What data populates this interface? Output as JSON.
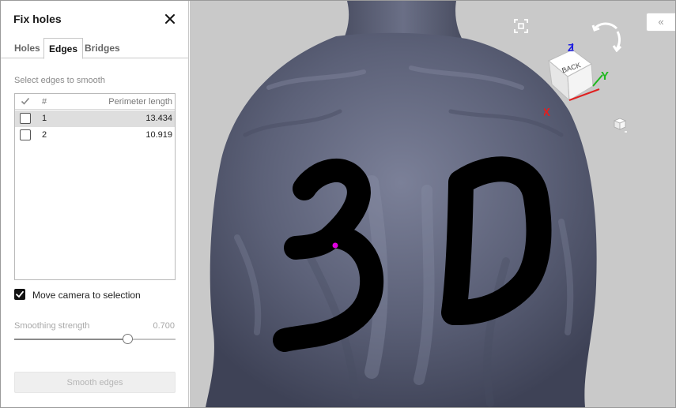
{
  "panel": {
    "title": "Fix holes",
    "tabs": [
      "Holes",
      "Edges",
      "Bridges"
    ],
    "active_tab": "Edges",
    "section_label": "Select edges to smooth",
    "list": {
      "header_num": "#",
      "header_perimeter": "Perimeter length",
      "rows": [
        {
          "id": "1",
          "perimeter": "13.434",
          "checked": false,
          "selected": true
        },
        {
          "id": "2",
          "perimeter": "10.919",
          "checked": false,
          "selected": false
        }
      ]
    },
    "move_camera_label": "Move camera to selection",
    "move_camera_checked": true,
    "smoothing_label": "Smoothing strength",
    "smoothing_value": "0.700",
    "smoothing_fraction": 0.7,
    "smooth_button": "Smooth edges"
  },
  "viewport": {
    "collapse_label": "«",
    "cube_face_label": "BACK",
    "axes": {
      "x": "X",
      "y": "Y",
      "z": "Z"
    },
    "axis_colors": {
      "x": "#e02020",
      "y": "#1db81d",
      "z": "#2020e0"
    },
    "model_color": "#595e74",
    "marker_color": "#e000e0",
    "model_text": "3D"
  }
}
